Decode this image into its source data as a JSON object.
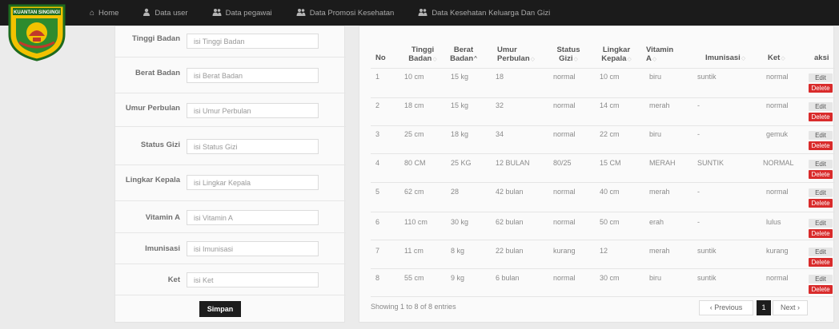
{
  "logo": {
    "text": "KUANTAN SINGINGI"
  },
  "nav": [
    {
      "label": "Home",
      "icon": "home-icon"
    },
    {
      "label": "Data user",
      "icon": "user-icon"
    },
    {
      "label": "Data pegawai",
      "icon": "users-icon"
    },
    {
      "label": "Data Promosi Kesehatan",
      "icon": "users-icon"
    },
    {
      "label": "Data Kesehatan Keluarga Dan Gizi",
      "icon": "users-icon"
    }
  ],
  "form": {
    "fields": [
      {
        "label": "Tinggi Badan",
        "placeholder": "isi Tinggi Badan"
      },
      {
        "label": "Berat Badan",
        "placeholder": "isi Berat Badan"
      },
      {
        "label": "Umur Perbulan",
        "placeholder": "isi Umur Perbulan"
      },
      {
        "label": "Status Gizi",
        "placeholder": "isi Status Gizi"
      },
      {
        "label": "Lingkar Kepala",
        "placeholder": "isi Lingkar Kepala"
      },
      {
        "label": "Vitamin A",
        "placeholder": "isi Vitamin A"
      },
      {
        "label": "Imunisasi",
        "placeholder": "isi Imunisasi"
      },
      {
        "label": "Ket",
        "placeholder": "isi Ket"
      }
    ],
    "submit_label": "Simpan"
  },
  "table": {
    "headers": [
      "No",
      "Tinggi Badan",
      "Berat Badan",
      "Umur Perbulan",
      "Status Gizi",
      "Lingkar Kepala",
      "Vitamin A",
      "Imunisasi",
      "Ket",
      "aksi"
    ],
    "rows": [
      [
        "1",
        "10 cm",
        "15 kg",
        "18",
        "normal",
        "10 cm",
        "biru",
        "suntik",
        "normal"
      ],
      [
        "2",
        "18 cm",
        "15 kg",
        "32",
        "normal",
        "14 cm",
        "merah",
        "-",
        "normal"
      ],
      [
        "3",
        "25 cm",
        "18 kg",
        "34",
        "normal",
        "22 cm",
        "biru",
        "-",
        "gemuk"
      ],
      [
        "4",
        "80 CM",
        "25 KG",
        "12 BULAN",
        "80/25",
        "15 CM",
        "MERAH",
        "SUNTIK",
        "NORMAL"
      ],
      [
        "5",
        "62 cm",
        "28",
        "42 bulan",
        "normal",
        "40 cm",
        "merah",
        "-",
        "normal"
      ],
      [
        "6",
        "110 cm",
        "30 kg",
        "62 bulan",
        "normal",
        "50 cm",
        "erah",
        "-",
        "lulus"
      ],
      [
        "7",
        "11 cm",
        "8 kg",
        "22 bulan",
        "kurang",
        "12",
        "merah",
        "suntik",
        "kurang"
      ],
      [
        "8",
        "55 cm",
        "9 kg",
        "6 bulan",
        "normal",
        "30 cm",
        "biru",
        "suntik",
        "normal"
      ]
    ],
    "edit_label": "Edit",
    "delete_label": "Delete",
    "info": "Showing 1 to 8 of 8 entries",
    "pagination": {
      "previous": "‹ Previous",
      "page": "1",
      "next": "Next ›"
    }
  },
  "colors": {
    "navbar": "#1b1b1b",
    "delete": "#d92b2b",
    "primary_button": "#1d1d1d"
  }
}
